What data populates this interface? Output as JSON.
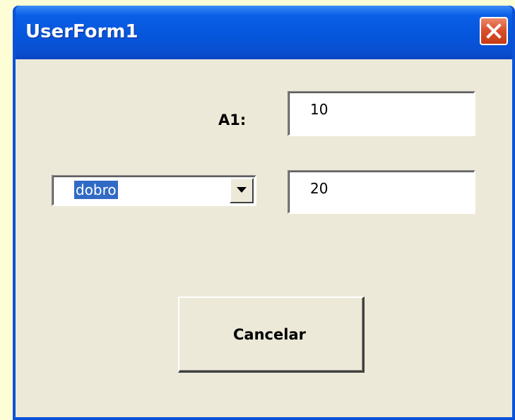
{
  "window": {
    "title": "UserForm1",
    "close_icon": "close-x-icon"
  },
  "form": {
    "a1_label": "A1:",
    "a1_value": "10",
    "operation_selected": "dobro",
    "dropdown_icon": "chevron-down-icon",
    "result_value": "20",
    "cancel_label": "Cancelar"
  },
  "colors": {
    "title_bar": "#0556dc",
    "client_bg": "#ece9d8",
    "close_button": "#d9522f",
    "selection": "#316ac5"
  }
}
